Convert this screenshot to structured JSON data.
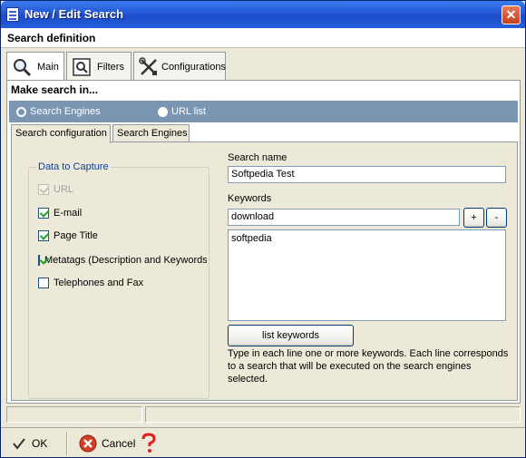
{
  "window": {
    "title": "New / Edit Search"
  },
  "header": {
    "section_title": "Search definition"
  },
  "main_tabs": [
    {
      "label": "Main",
      "icon": "magnifier-icon"
    },
    {
      "label": "Filters",
      "icon": "filter-icon"
    },
    {
      "label": "Configurations",
      "icon": "tools-icon"
    }
  ],
  "make_search": {
    "label": "Make search in...",
    "options": [
      {
        "label": "Search Engines",
        "selected": true
      },
      {
        "label": "URL list",
        "selected": false
      }
    ]
  },
  "sub_tabs": [
    {
      "label": "Search configuration"
    },
    {
      "label": "Search Engines"
    }
  ],
  "capture": {
    "title": "Data to Capture",
    "items": [
      {
        "label": "URL",
        "checked": true,
        "enabled": false
      },
      {
        "label": "E-mail",
        "checked": true,
        "enabled": true
      },
      {
        "label": "Page Title",
        "checked": true,
        "enabled": true
      },
      {
        "label": "Metatags (Description and Keywords)",
        "checked": true,
        "enabled": true
      },
      {
        "label": "Telephones and Fax",
        "checked": false,
        "enabled": true
      }
    ]
  },
  "search_name": {
    "label": "Search name",
    "value": "Softpedia Test"
  },
  "keywords": {
    "label": "Keywords",
    "input_value": "download",
    "add_label": "+",
    "remove_label": "-",
    "list_value": "softpedia",
    "list_button": "list keywords",
    "help": "Type in each line one or more keywords. Each line corresponds to a search that will be executed on the search engines selected."
  },
  "buttons": {
    "ok": "OK",
    "cancel": "Cancel"
  },
  "colors": {
    "title_bar": "#245edb",
    "band": "#7b96b3",
    "panel": "#ece9d8"
  }
}
